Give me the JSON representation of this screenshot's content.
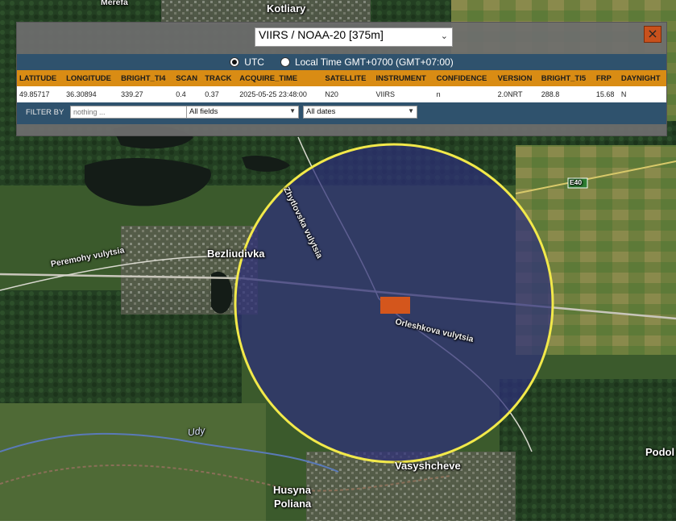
{
  "map": {
    "places": {
      "kotliary": "Kotliary",
      "merefa": "Merefa",
      "bezliudivka": "Bezliudivka",
      "vasyshcheve": "Vasyshcheve",
      "husyna_1": "Husyna",
      "husyna_2": "Poliana",
      "podol": "Podol"
    },
    "roads": {
      "zhytlova": "Zhytlovska vulytsia",
      "peremohy": "Peremohy vulytsia",
      "orleshkova": "Orleshkova vulytsia",
      "e40": "E40"
    },
    "water": {
      "udy": "Udy"
    },
    "colors": {
      "circle": "#f2e94a",
      "hotspot": "#d4561c",
      "overlay": "#3c3c8c"
    }
  },
  "panel": {
    "satellite_select": "VIIRS / NOAA-20 [375m]",
    "close": "×",
    "tz": {
      "utc": "UTC",
      "local": "Local Time GMT+0700 (GMT+07:00)",
      "selected": "utc"
    },
    "table": {
      "headers": [
        "LATITUDE",
        "LONGITUDE",
        "BRIGHT_TI4",
        "SCAN",
        "TRACK",
        "ACQUIRE_TIME",
        "SATELLITE",
        "INSTRUMENT",
        "CONFIDENCE",
        "VERSION",
        "BRIGHT_TI5",
        "FRP",
        "DAYNIGHT"
      ],
      "rows": [
        [
          "49.85717",
          "36.30894",
          "339.27",
          "0.4",
          "0.37",
          "2025-05-25 23:48:00",
          "N20",
          "VIIRS",
          "n",
          "2.0NRT",
          "288.8",
          "15.68",
          "N"
        ]
      ]
    },
    "filter": {
      "label": "FILTER BY",
      "placeholder": "nothing ...",
      "fields_value": "All fields",
      "dates_value": "All dates"
    }
  }
}
